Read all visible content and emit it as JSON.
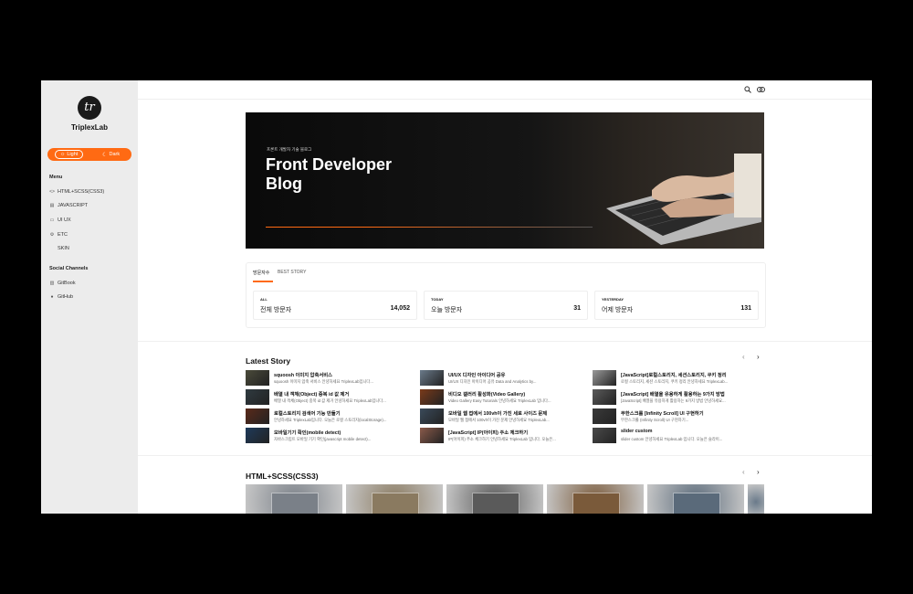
{
  "sidebar": {
    "logo_mark": "tr",
    "brand": "TriplexLab",
    "theme_light": "Light",
    "theme_dark": "Dark",
    "menu_heading": "Menu",
    "menu": [
      {
        "label": "HTML+SCSS(CSS3)",
        "icon": "code-icon"
      },
      {
        "label": "JAVASCRIPT",
        "icon": "file-icon"
      },
      {
        "label": "UI UX",
        "icon": "monitor-icon"
      },
      {
        "label": "ETC",
        "icon": "gear-icon"
      },
      {
        "label": "SKIN",
        "icon": ""
      }
    ],
    "social_heading": "Social Channels",
    "social": [
      {
        "label": "GitBook",
        "icon": "book-icon"
      },
      {
        "label": "GitHub",
        "icon": "github-icon"
      }
    ]
  },
  "topbar": {
    "search_icon": "search-icon",
    "profile_icon": "profile-icon"
  },
  "hero": {
    "subtitle": "프론트 개발자 기술 블로그",
    "title": "Front Developer Blog"
  },
  "stats": {
    "tabs": [
      "방문자수",
      "BEST STORY"
    ],
    "cards": [
      {
        "small": "ALL",
        "label": "전체 방문자",
        "value": "14,052"
      },
      {
        "small": "TODAY",
        "label": "오늘 방문자",
        "value": "31"
      },
      {
        "small": "YESTERDAY",
        "label": "어제 방문자",
        "value": "131"
      }
    ]
  },
  "latest": {
    "title": "Latest Story",
    "prev": "‹",
    "next": "›",
    "columns": [
      [
        {
          "title": "squoosh 이미지 압축서비스",
          "excerpt": "squoosh 이미지 압축 서비스 안녕하세요 TriplexLab입니다...",
          "thumb": "#4a4a3a"
        },
        {
          "title": "배열 내 객체(Object) 중복 id 값 제거",
          "excerpt": "배열 내 객체(Object) 중복 id 값 제거 안녕하세요 TriplexLab입니다...",
          "thumb": "#2f3a40"
        },
        {
          "title": "로컬스토리지 검색어 기능 만들기",
          "excerpt": "안녕하세요 TriplexLab입니다. 오늘은 로컬 스토리지(localStorage)...",
          "thumb": "#5a2a1a"
        },
        {
          "title": "모바일기기 확인(mobile detect)",
          "excerpt": "자바스크립트 모바일 기기 확인(javascript mobile detect)...",
          "thumb": "#1e3a5a"
        }
      ],
      [
        {
          "title": "UI/UX 디자인 아이디어 공유",
          "excerpt": "UI/UX 디자인 아이디어 공유 Data and Analytics by...",
          "thumb": "#6a7a8a"
        },
        {
          "title": "비디오 갤러리 활성화(Video Gallery)",
          "excerpt": "Video Gallery Easy Tutorials 안녕하세요 TriplexLab 입니다...",
          "thumb": "#7a3a1a"
        },
        {
          "title": "모바일 웹 접에서 100vh이 가진 세로 사이즈 문제",
          "excerpt": "모바일 웹 접에서 100vh이 가진 문제 안녕하세요 TriplexLab...",
          "thumb": "#3a4a5a"
        },
        {
          "title": "[JavaScript] IP(아이피) 주소 체크하기",
          "excerpt": "IP(아이피) 주소 체크하기 안녕하세요 TriplexLab 입니다. 오늘은...",
          "thumb": "#8a5a4a"
        }
      ],
      [
        {
          "title": "[JavaScript]로컬스토리지, 세션스토리지, 쿠키 정리",
          "excerpt": "로컬 스토리지, 세션 스토리지, 쿠키 정리 안녕하세요 TriplexLab...",
          "thumb": "#9a9a9a"
        },
        {
          "title": "[JavaScript] 배열을 유용하게 활용하는 9가지 방법",
          "excerpt": "[JavaScript] 배열을 유용하게 활용하는 9가지 방법 안녕하세요...",
          "thumb": "#5a5a5a"
        },
        {
          "title": "무한스크롤 [Infinity Scroll] UI 구현하기",
          "excerpt": "무한스크롤 (Infinity Scroll) UI 구현하기...",
          "thumb": "#3a3a3a"
        },
        {
          "title": "slider custom",
          "excerpt": "slider custom 안녕하세요 TriplexLab 입니다. 오늘은 슬라이...",
          "thumb": "#4a4a4a"
        }
      ]
    ]
  },
  "html_section": {
    "title": "HTML+SCSS(CSS3)",
    "prev": "‹",
    "next": "›",
    "cards": [
      {
        "color": "#7a8088"
      },
      {
        "color": "#8a7a60"
      },
      {
        "color": "#5a5a5a"
      },
      {
        "color": "#7a5a3a"
      },
      {
        "color": "#5a6a7a"
      },
      {
        "color": "#6a7a8a"
      }
    ]
  }
}
